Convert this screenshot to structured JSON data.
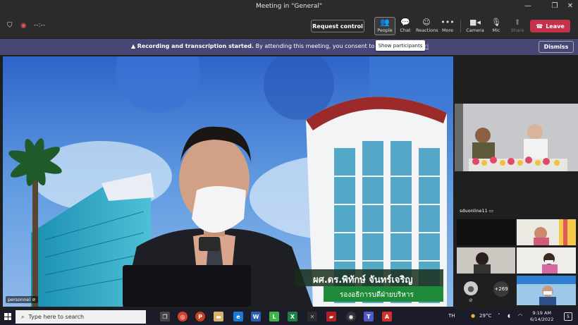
{
  "window": {
    "title": "Meeting in \"General\""
  },
  "toolbar": {
    "timer": "--:--",
    "request_control": "Request control",
    "people_label": "People",
    "chat_label": "Chat",
    "reactions_label": "Reactions",
    "more_label": "More",
    "camera_label": "Camera",
    "mic_label": "Mic",
    "share_label": "Share",
    "leave_label": "Leave",
    "tooltip": "Show participants"
  },
  "banner": {
    "bold_text": "Recording and transcription started.",
    "text": " By attending this meeting, you consent to being included. ",
    "link_text": "Pri",
    "dismiss_label": "Dismiss"
  },
  "stage": {
    "speaker_name": "personnel",
    "caption_name": "ผศ.ดร.พิทักษ์ จันทร์เจริญ",
    "caption_title": "รองอธิการบดีฝ่ายบริหาร"
  },
  "participants": {
    "tile1_name": "sduonline11",
    "overflow_count": "+269"
  },
  "taskbar": {
    "search_placeholder": "Type here to search",
    "language": "TH",
    "temperature": "29°C",
    "time": "9:19 AM",
    "date": "6/14/2022",
    "notification_count": "5"
  },
  "colors": {
    "leave": "#c4314b",
    "banner": "#464775",
    "caption_green": "#1f8a3a",
    "caption_dark": "#1a2e1a"
  }
}
